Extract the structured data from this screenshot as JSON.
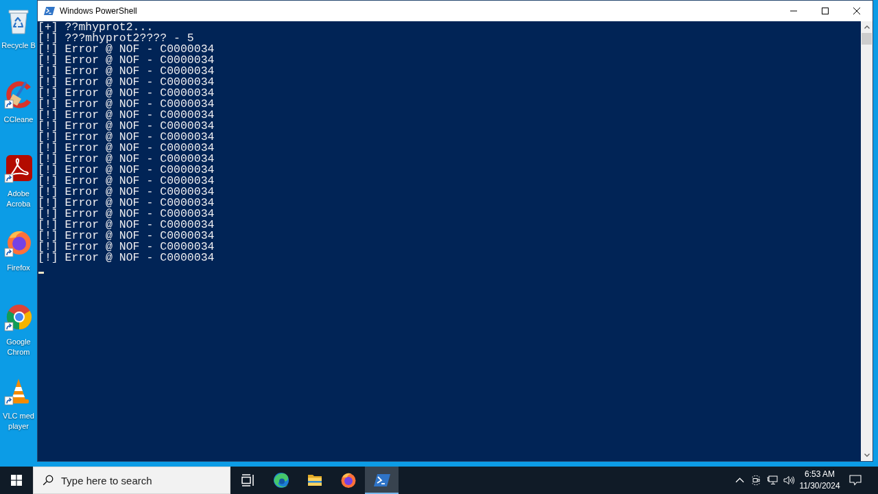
{
  "desktop": {
    "icons": [
      {
        "kind": "recycle-bin",
        "label": "Recycle B"
      },
      {
        "kind": "ccleaner",
        "label": "CCleane"
      },
      {
        "kind": "acrobat",
        "label": "Adobe Acroba"
      },
      {
        "kind": "firefox",
        "label": "Firefox"
      },
      {
        "kind": "chrome",
        "label": "Google Chrom"
      },
      {
        "kind": "vlc",
        "label": "VLC med player"
      }
    ]
  },
  "window": {
    "title": "Windows PowerShell",
    "console": {
      "lines": [
        "[+] ??mhyprot2...",
        "[!] ???mhyprot2???? - 5",
        "[!] Error @ NOF - C0000034",
        "[!] Error @ NOF - C0000034",
        "[!] Error @ NOF - C0000034",
        "[!] Error @ NOF - C0000034",
        "[!] Error @ NOF - C0000034",
        "[!] Error @ NOF - C0000034",
        "[!] Error @ NOF - C0000034",
        "[!] Error @ NOF - C0000034",
        "[!] Error @ NOF - C0000034",
        "[!] Error @ NOF - C0000034",
        "[!] Error @ NOF - C0000034",
        "[!] Error @ NOF - C0000034",
        "[!] Error @ NOF - C0000034",
        "[!] Error @ NOF - C0000034",
        "[!] Error @ NOF - C0000034",
        "[!] Error @ NOF - C0000034",
        "[!] Error @ NOF - C0000034",
        "[!] Error @ NOF - C0000034",
        "[!] Error @ NOF - C0000034",
        "[!] Error @ NOF - C0000034"
      ]
    }
  },
  "taskbar": {
    "search": {
      "placeholder": "Type here to search"
    },
    "apps": [
      {
        "kind": "task-view",
        "selected": false
      },
      {
        "kind": "edge",
        "selected": false
      },
      {
        "kind": "file-explorer",
        "selected": false
      },
      {
        "kind": "firefox",
        "selected": false
      },
      {
        "kind": "powershell",
        "selected": true
      }
    ],
    "tray": {
      "time": "6:53 AM",
      "date": "11/30/2024"
    }
  }
}
